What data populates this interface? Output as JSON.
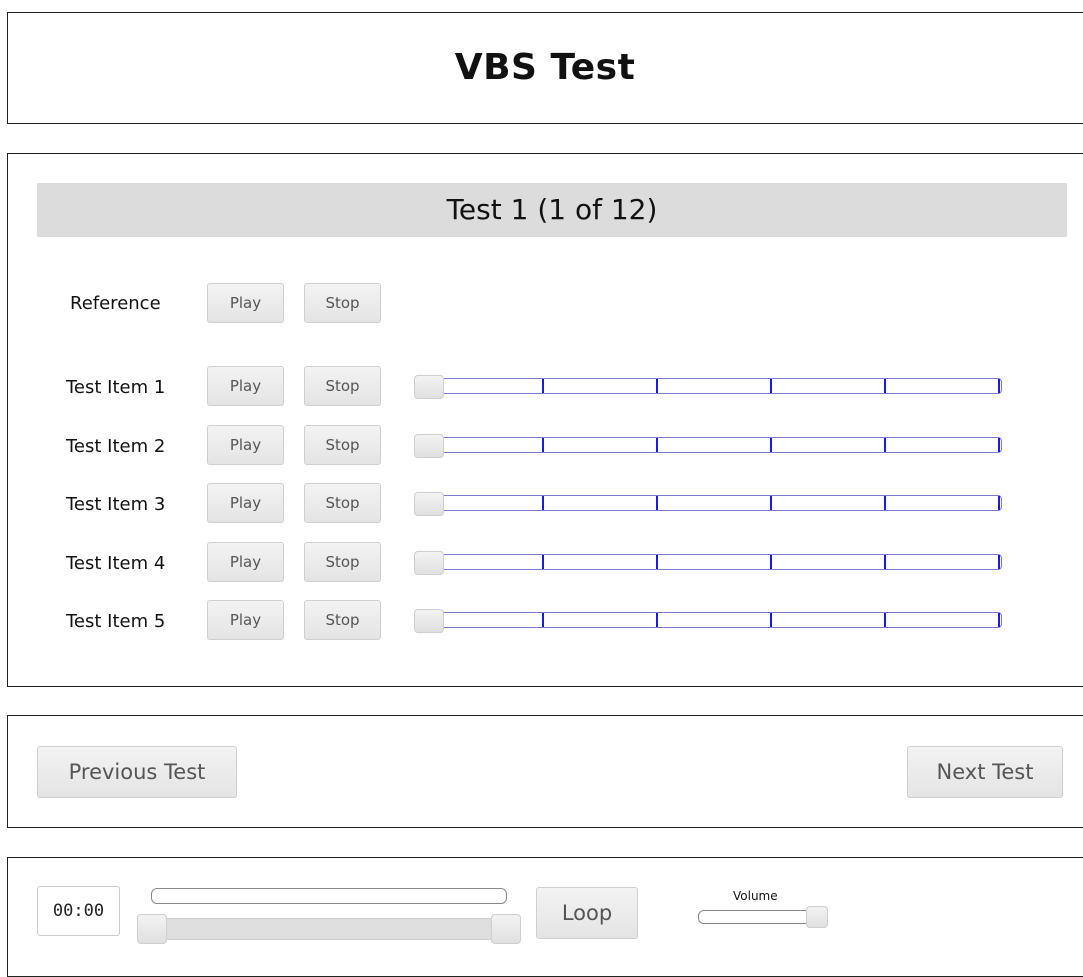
{
  "header": {
    "title": "VBS Test"
  },
  "test": {
    "title": "Test 1 (1 of 12)",
    "reference": {
      "label": "Reference",
      "play_label": "Play",
      "stop_label": "Stop"
    },
    "items": [
      {
        "label": "Test Item 1",
        "play_label": "Play",
        "stop_label": "Stop",
        "rating": 0
      },
      {
        "label": "Test Item 2",
        "play_label": "Play",
        "stop_label": "Stop",
        "rating": 0
      },
      {
        "label": "Test Item 3",
        "play_label": "Play",
        "stop_label": "Stop",
        "rating": 0
      },
      {
        "label": "Test Item 4",
        "play_label": "Play",
        "stop_label": "Stop",
        "rating": 0
      },
      {
        "label": "Test Item 5",
        "play_label": "Play",
        "stop_label": "Stop",
        "rating": 0
      }
    ]
  },
  "nav": {
    "previous_label": "Previous Test",
    "next_label": "Next Test"
  },
  "player": {
    "time": "00:00",
    "loop_label": "Loop",
    "volume_label": "Volume",
    "volume_level": 1.0
  },
  "colors": {
    "tick": "#1a1ae6",
    "title_band": "#dcdcdc"
  }
}
